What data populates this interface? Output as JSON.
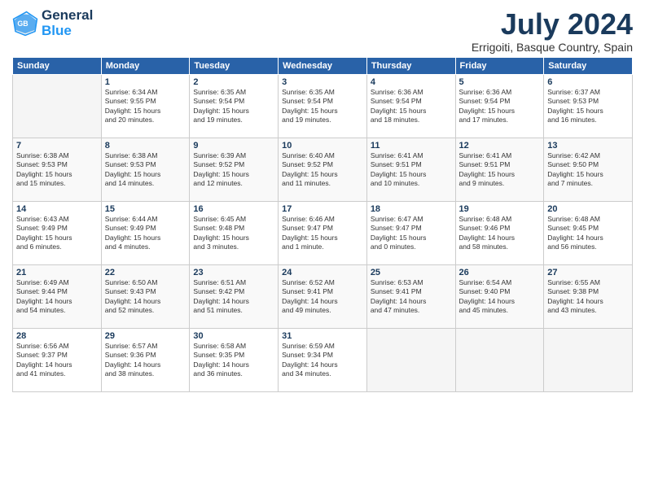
{
  "logo": {
    "line1": "General",
    "line2": "Blue"
  },
  "title": "July 2024",
  "location": "Errigoiti, Basque Country, Spain",
  "days_header": [
    "Sunday",
    "Monday",
    "Tuesday",
    "Wednesday",
    "Thursday",
    "Friday",
    "Saturday"
  ],
  "weeks": [
    [
      {
        "day": "",
        "info": ""
      },
      {
        "day": "1",
        "info": "Sunrise: 6:34 AM\nSunset: 9:55 PM\nDaylight: 15 hours\nand 20 minutes."
      },
      {
        "day": "2",
        "info": "Sunrise: 6:35 AM\nSunset: 9:54 PM\nDaylight: 15 hours\nand 19 minutes."
      },
      {
        "day": "3",
        "info": "Sunrise: 6:35 AM\nSunset: 9:54 PM\nDaylight: 15 hours\nand 19 minutes."
      },
      {
        "day": "4",
        "info": "Sunrise: 6:36 AM\nSunset: 9:54 PM\nDaylight: 15 hours\nand 18 minutes."
      },
      {
        "day": "5",
        "info": "Sunrise: 6:36 AM\nSunset: 9:54 PM\nDaylight: 15 hours\nand 17 minutes."
      },
      {
        "day": "6",
        "info": "Sunrise: 6:37 AM\nSunset: 9:53 PM\nDaylight: 15 hours\nand 16 minutes."
      }
    ],
    [
      {
        "day": "7",
        "info": "Sunrise: 6:38 AM\nSunset: 9:53 PM\nDaylight: 15 hours\nand 15 minutes."
      },
      {
        "day": "8",
        "info": "Sunrise: 6:38 AM\nSunset: 9:53 PM\nDaylight: 15 hours\nand 14 minutes."
      },
      {
        "day": "9",
        "info": "Sunrise: 6:39 AM\nSunset: 9:52 PM\nDaylight: 15 hours\nand 12 minutes."
      },
      {
        "day": "10",
        "info": "Sunrise: 6:40 AM\nSunset: 9:52 PM\nDaylight: 15 hours\nand 11 minutes."
      },
      {
        "day": "11",
        "info": "Sunrise: 6:41 AM\nSunset: 9:51 PM\nDaylight: 15 hours\nand 10 minutes."
      },
      {
        "day": "12",
        "info": "Sunrise: 6:41 AM\nSunset: 9:51 PM\nDaylight: 15 hours\nand 9 minutes."
      },
      {
        "day": "13",
        "info": "Sunrise: 6:42 AM\nSunset: 9:50 PM\nDaylight: 15 hours\nand 7 minutes."
      }
    ],
    [
      {
        "day": "14",
        "info": "Sunrise: 6:43 AM\nSunset: 9:49 PM\nDaylight: 15 hours\nand 6 minutes."
      },
      {
        "day": "15",
        "info": "Sunrise: 6:44 AM\nSunset: 9:49 PM\nDaylight: 15 hours\nand 4 minutes."
      },
      {
        "day": "16",
        "info": "Sunrise: 6:45 AM\nSunset: 9:48 PM\nDaylight: 15 hours\nand 3 minutes."
      },
      {
        "day": "17",
        "info": "Sunrise: 6:46 AM\nSunset: 9:47 PM\nDaylight: 15 hours\nand 1 minute."
      },
      {
        "day": "18",
        "info": "Sunrise: 6:47 AM\nSunset: 9:47 PM\nDaylight: 15 hours\nand 0 minutes."
      },
      {
        "day": "19",
        "info": "Sunrise: 6:48 AM\nSunset: 9:46 PM\nDaylight: 14 hours\nand 58 minutes."
      },
      {
        "day": "20",
        "info": "Sunrise: 6:48 AM\nSunset: 9:45 PM\nDaylight: 14 hours\nand 56 minutes."
      }
    ],
    [
      {
        "day": "21",
        "info": "Sunrise: 6:49 AM\nSunset: 9:44 PM\nDaylight: 14 hours\nand 54 minutes."
      },
      {
        "day": "22",
        "info": "Sunrise: 6:50 AM\nSunset: 9:43 PM\nDaylight: 14 hours\nand 52 minutes."
      },
      {
        "day": "23",
        "info": "Sunrise: 6:51 AM\nSunset: 9:42 PM\nDaylight: 14 hours\nand 51 minutes."
      },
      {
        "day": "24",
        "info": "Sunrise: 6:52 AM\nSunset: 9:41 PM\nDaylight: 14 hours\nand 49 minutes."
      },
      {
        "day": "25",
        "info": "Sunrise: 6:53 AM\nSunset: 9:41 PM\nDaylight: 14 hours\nand 47 minutes."
      },
      {
        "day": "26",
        "info": "Sunrise: 6:54 AM\nSunset: 9:40 PM\nDaylight: 14 hours\nand 45 minutes."
      },
      {
        "day": "27",
        "info": "Sunrise: 6:55 AM\nSunset: 9:38 PM\nDaylight: 14 hours\nand 43 minutes."
      }
    ],
    [
      {
        "day": "28",
        "info": "Sunrise: 6:56 AM\nSunset: 9:37 PM\nDaylight: 14 hours\nand 41 minutes."
      },
      {
        "day": "29",
        "info": "Sunrise: 6:57 AM\nSunset: 9:36 PM\nDaylight: 14 hours\nand 38 minutes."
      },
      {
        "day": "30",
        "info": "Sunrise: 6:58 AM\nSunset: 9:35 PM\nDaylight: 14 hours\nand 36 minutes."
      },
      {
        "day": "31",
        "info": "Sunrise: 6:59 AM\nSunset: 9:34 PM\nDaylight: 14 hours\nand 34 minutes."
      },
      {
        "day": "",
        "info": ""
      },
      {
        "day": "",
        "info": ""
      },
      {
        "day": "",
        "info": ""
      }
    ]
  ]
}
